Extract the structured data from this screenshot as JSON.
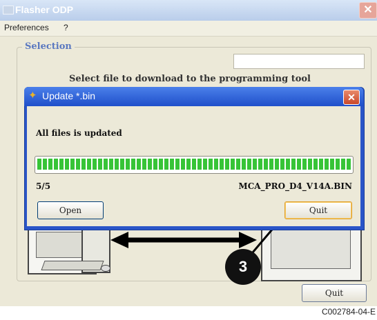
{
  "main_window": {
    "title": "Flasher ODP",
    "menu": [
      "Preferences",
      "?"
    ],
    "selection_legend": "Selection",
    "instruction": "Select file to download to the programming tool",
    "quit_label": "Quit"
  },
  "dialog": {
    "title": "Update *.bin",
    "status": "All files is updated",
    "progress_fraction": 1.0,
    "count": "5/5",
    "filename": "MCA_PRO_D4_V14A.BIN",
    "open_label": "Open",
    "quit_label": "Quit"
  },
  "callout": {
    "number": "3"
  },
  "caption": "C002784-04-E",
  "colors": {
    "dialog_frame": "#2a55c8",
    "progress_green": "#37c437",
    "legend_blue": "#5a78c0"
  },
  "icons": [
    "app-icon",
    "close-icon",
    "dialog-icon",
    "arrow-double-icon",
    "pointer-arrow-icon"
  ]
}
